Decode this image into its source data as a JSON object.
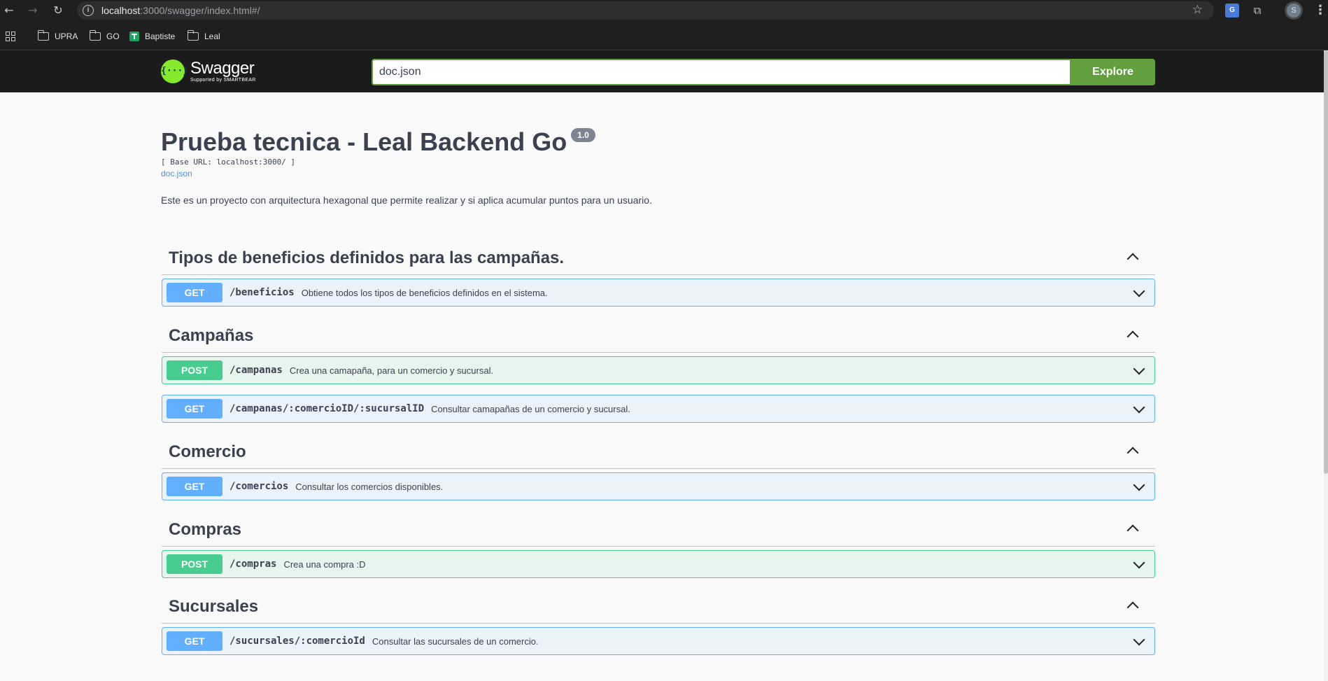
{
  "browser": {
    "url_host": "localhost",
    "url_rest": ":3000/swagger/index.html#/",
    "profile_initial": "S",
    "translate_label": "G"
  },
  "bookmarks": [
    {
      "label": "UPRA",
      "icon": "folder-icon"
    },
    {
      "label": "GO",
      "icon": "folder-icon"
    },
    {
      "label": "Baptiste",
      "icon": "sheet-icon"
    },
    {
      "label": "Leal",
      "icon": "folder-icon"
    }
  ],
  "topbar": {
    "logo_title": "Swagger",
    "logo_subtitle": "Supported by SMARTBEAR",
    "logo_mark": "{···}",
    "spec_url": "doc.json",
    "explore_label": "Explore",
    "accent_color": "#62a03f"
  },
  "info": {
    "title": "Prueba tecnica - Leal Backend Go",
    "version": "1.0",
    "base_url": "[ Base URL: localhost:3000/ ]",
    "spec_link": "doc.json",
    "description": "Este es un proyecto con arquitectura hexagonal que permite realizar y si aplica acumular puntos para un usuario."
  },
  "method_colors": {
    "GET": "#61affe",
    "POST": "#49cc90"
  },
  "tags": [
    {
      "name": "Tipos de beneficios definidos para las campañas.",
      "operations": [
        {
          "method": "GET",
          "path": "/beneficios",
          "summary": "Obtiene todos los tipos de beneficios definidos en el sistema."
        }
      ]
    },
    {
      "name": "Campañas",
      "operations": [
        {
          "method": "POST",
          "path": "/campanas",
          "summary": "Crea una camapaña, para un comercio y sucursal."
        },
        {
          "method": "GET",
          "path": "/campanas/:comercioID/:sucursalID",
          "summary": "Consultar camapañas de un comercio y sucursal."
        }
      ]
    },
    {
      "name": "Comercio",
      "operations": [
        {
          "method": "GET",
          "path": "/comercios",
          "summary": "Consultar los comercios disponibles."
        }
      ]
    },
    {
      "name": "Compras",
      "operations": [
        {
          "method": "POST",
          "path": "/compras",
          "summary": "Crea una compra :D"
        }
      ]
    },
    {
      "name": "Sucursales",
      "operations": [
        {
          "method": "GET",
          "path": "/sucursales/:comercioId",
          "summary": "Consultar las sucursales de un comercio."
        }
      ]
    }
  ]
}
